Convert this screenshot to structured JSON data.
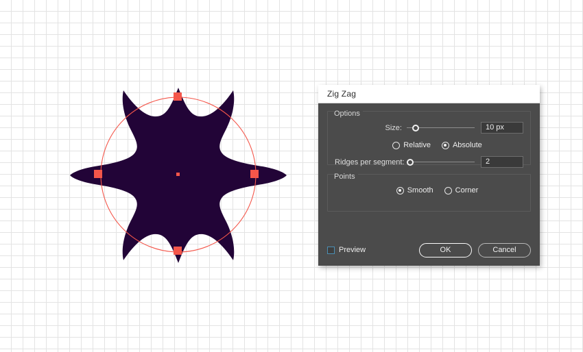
{
  "canvas": {
    "grid_color": "#e3e3e3",
    "background": "#ffffff",
    "artwork": {
      "name": "six-point-star-blob",
      "fill": "#220437",
      "selection_color": "#f4564a"
    }
  },
  "dialog": {
    "title": "Zig Zag",
    "options_group": {
      "label": "Options",
      "size": {
        "label": "Size:",
        "value": "10 px",
        "slider_position_pct": 4
      },
      "mode": {
        "relative": {
          "label": "Relative",
          "selected": false
        },
        "absolute": {
          "label": "Absolute",
          "selected": true
        }
      },
      "ridges": {
        "label": "Ridges per segment:",
        "value": "2",
        "slider_position_pct": 0
      }
    },
    "points_group": {
      "label": "Points",
      "smooth": {
        "label": "Smooth",
        "selected": true
      },
      "corner": {
        "label": "Corner",
        "selected": false
      }
    },
    "footer": {
      "preview": {
        "label": "Preview",
        "checked": false,
        "accent": "#4b8fb5"
      },
      "ok_label": "OK",
      "cancel_label": "Cancel"
    }
  }
}
